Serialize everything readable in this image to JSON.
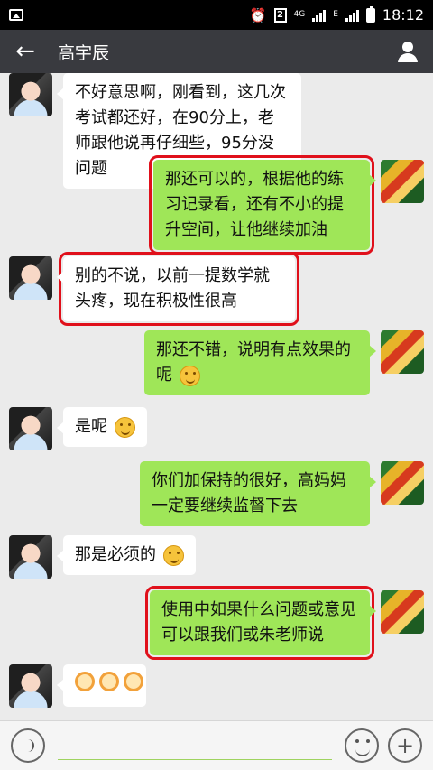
{
  "status": {
    "sim": "2",
    "network": "4G",
    "network_type": "E",
    "time": "18:12"
  },
  "header": {
    "title": "高宇辰"
  },
  "messages": [
    {
      "text": "不好意思啊，刚看到，这几次考试都还好，在90分上，老师跟他说再仔细些，95分没问题"
    },
    {
      "text": "那还可以的，根据他的练习记录看，还有不小的提升空间，让他继续加油"
    },
    {
      "text": "别的不说，以前一提数学就头疼，现在积极性很高"
    },
    {
      "text": "那还不错，说明有点效果的呢"
    },
    {
      "text": "是呢"
    },
    {
      "text": "你们加保持的很好，高妈妈一定要继续监督下去"
    },
    {
      "text": "那是必须的"
    },
    {
      "text": "使用中如果什么问题或意见可以跟我们或朱老师说"
    }
  ]
}
